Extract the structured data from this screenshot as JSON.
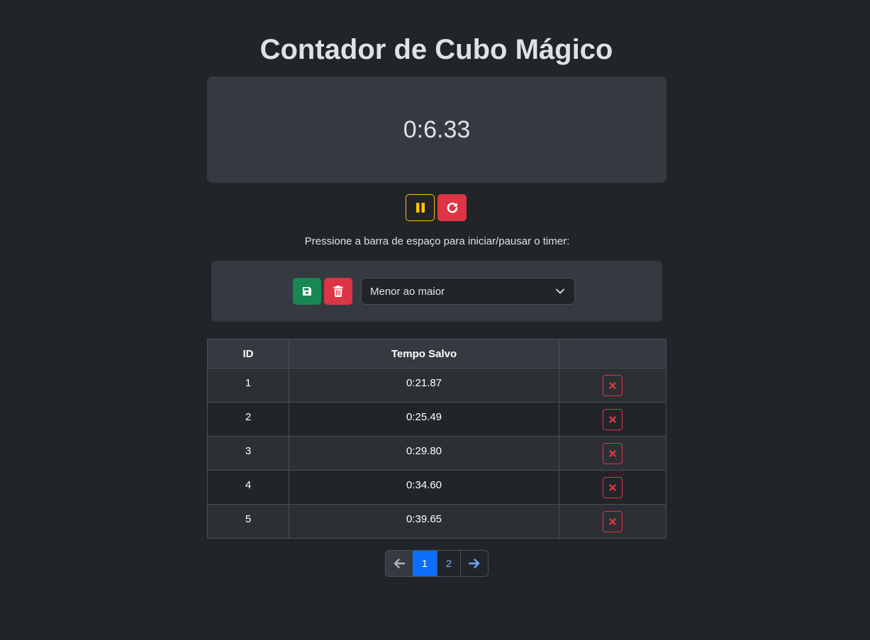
{
  "app": {
    "title": "Contador de Cubo Mágico"
  },
  "timer": {
    "display": "0:6.33"
  },
  "controls": {
    "pause_icon": "pause-icon",
    "reset_icon": "rotate-right-icon"
  },
  "hint": "Pressione a barra de espaço para iniciar/pausar o timer:",
  "save_panel": {
    "save_icon": "floppy-disk-icon",
    "clear_icon": "trash-icon",
    "sort_select": {
      "selected": "Menor ao maior"
    }
  },
  "table": {
    "headers": [
      "ID",
      "Tempo Salvo",
      ""
    ],
    "rows": [
      {
        "id": "1",
        "time": "0:21.87"
      },
      {
        "id": "2",
        "time": "0:25.49"
      },
      {
        "id": "3",
        "time": "0:29.80"
      },
      {
        "id": "4",
        "time": "0:34.60"
      },
      {
        "id": "5",
        "time": "0:39.65"
      }
    ]
  },
  "pagination": {
    "pages": [
      "1",
      "2"
    ],
    "current": "1"
  },
  "colors": {
    "background": "#212529",
    "panel": "#343a40",
    "warning": "#ffc107",
    "danger": "#dc3545",
    "success": "#198754",
    "primary": "#0d6efd"
  }
}
